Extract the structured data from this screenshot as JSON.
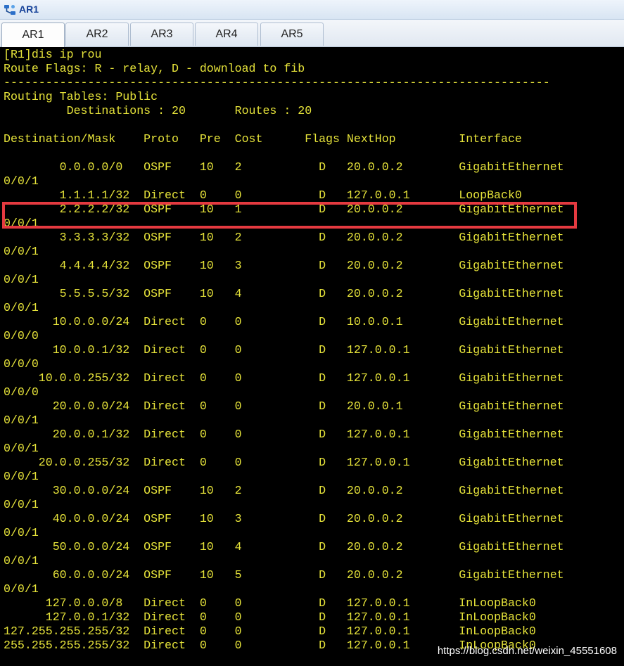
{
  "window": {
    "title": "AR1",
    "icon": "router-network-icon"
  },
  "tabs": [
    {
      "label": "AR1",
      "active": true
    },
    {
      "label": "AR2",
      "active": false
    },
    {
      "label": "AR3",
      "active": false
    },
    {
      "label": "AR4",
      "active": false
    },
    {
      "label": "AR5",
      "active": false
    }
  ],
  "terminal": {
    "text_color": "#e6e33a",
    "background": "#000000",
    "lines": [
      "[R1]dis ip rou",
      "Route Flags: R - relay, D - download to fib",
      "------------------------------------------------------------------------------",
      "Routing Tables: Public",
      "         Destinations : 20       Routes : 20",
      "",
      "Destination/Mask    Proto   Pre  Cost      Flags NextHop         Interface",
      "",
      "        0.0.0.0/0   OSPF    10   2           D   20.0.0.2        GigabitEthernet",
      "0/0/1",
      "        1.1.1.1/32  Direct  0    0           D   127.0.0.1       LoopBack0",
      "        2.2.2.2/32  OSPF    10   1           D   20.0.0.2        GigabitEthernet",
      "0/0/1",
      "        3.3.3.3/32  OSPF    10   2           D   20.0.0.2        GigabitEthernet",
      "0/0/1",
      "        4.4.4.4/32  OSPF    10   3           D   20.0.0.2        GigabitEthernet",
      "0/0/1",
      "        5.5.5.5/32  OSPF    10   4           D   20.0.0.2        GigabitEthernet",
      "0/0/1",
      "       10.0.0.0/24  Direct  0    0           D   10.0.0.1        GigabitEthernet",
      "0/0/0",
      "       10.0.0.1/32  Direct  0    0           D   127.0.0.1       GigabitEthernet",
      "0/0/0",
      "     10.0.0.255/32  Direct  0    0           D   127.0.0.1       GigabitEthernet",
      "0/0/0",
      "       20.0.0.0/24  Direct  0    0           D   20.0.0.1        GigabitEthernet",
      "0/0/1",
      "       20.0.0.1/32  Direct  0    0           D   127.0.0.1       GigabitEthernet",
      "0/0/1",
      "     20.0.0.255/32  Direct  0    0           D   127.0.0.1       GigabitEthernet",
      "0/0/1",
      "       30.0.0.0/24  OSPF    10   2           D   20.0.0.2        GigabitEthernet",
      "0/0/1",
      "       40.0.0.0/24  OSPF    10   3           D   20.0.0.2        GigabitEthernet",
      "0/0/1",
      "       50.0.0.0/24  OSPF    10   4           D   20.0.0.2        GigabitEthernet",
      "0/0/1",
      "       60.0.0.0/24  OSPF    10   5           D   20.0.0.2        GigabitEthernet",
      "0/0/1",
      "      127.0.0.0/8   Direct  0    0           D   127.0.0.1       InLoopBack0",
      "      127.0.0.1/32  Direct  0    0           D   127.0.0.1       InLoopBack0",
      "127.255.255.255/32  Direct  0    0           D   127.0.0.1       InLoopBack0",
      "255.255.255.255/32  Direct  0    0           D   127.0.0.1       InLoopBack0"
    ]
  },
  "annotation": {
    "highlight_color": "#e53a40"
  },
  "watermark": "https://blog.csdn.net/weixin_45551608"
}
